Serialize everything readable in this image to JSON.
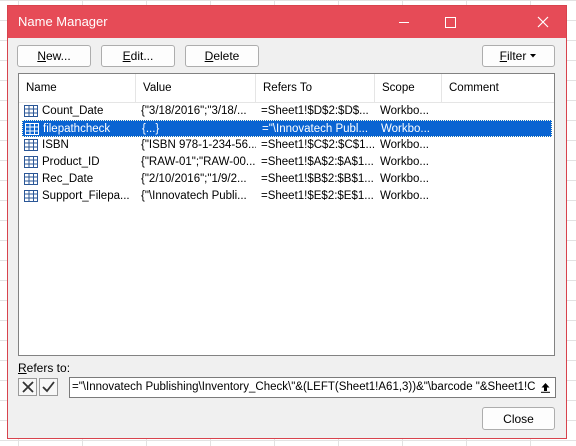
{
  "window": {
    "title": "Name Manager"
  },
  "toolbar": {
    "new_prefix": "N",
    "new_rest": "ew...",
    "edit_prefix": "E",
    "edit_rest": "dit...",
    "delete_prefix": "D",
    "delete_rest": "elete",
    "filter_prefix": "F",
    "filter_rest": "ilter"
  },
  "columns": [
    "Name",
    "Value",
    "Refers To",
    "Scope",
    "Comment"
  ],
  "rows": [
    {
      "name": "Count_Date",
      "value": "{\"3/18/2016\";\"3/18/...",
      "refers": "=Sheet1!$D$2:$D$...",
      "scope": "Workbo...",
      "comment": ""
    },
    {
      "name": "filepathcheck",
      "value": "{...}",
      "refers": "=\"\\Innovatech Publ...",
      "scope": "Workbo...",
      "comment": ""
    },
    {
      "name": "ISBN",
      "value": "{\"ISBN 978-1-234-56...",
      "refers": "=Sheet1!$C$2:$C$1...",
      "scope": "Workbo...",
      "comment": ""
    },
    {
      "name": "Product_ID",
      "value": "{\"RAW-01\";\"RAW-00...",
      "refers": "=Sheet1!$A$2:$A$1...",
      "scope": "Workbo...",
      "comment": ""
    },
    {
      "name": "Rec_Date",
      "value": "{\"2/10/2016\";\"1/9/2...",
      "refers": "=Sheet1!$B$2:$B$1...",
      "scope": "Workbo...",
      "comment": ""
    },
    {
      "name": "Support_Filepa...",
      "value": "{\"\\Innovatech Publi...",
      "refers": "=Sheet1!$E$2:$E$1...",
      "scope": "Workbo...",
      "comment": ""
    }
  ],
  "selected_row": 1,
  "refers_to": {
    "label_prefix": "R",
    "label_rest": "efers to:",
    "value": "=\"\\Innovatech Publishing\\Inventory_Check\\\"&(LEFT(Sheet1!A61,3))&\"\\barcode \"&Sheet1!C"
  },
  "footer": {
    "close_label": "Close"
  },
  "colors": {
    "titlebar": "#e64b57",
    "selection": "#0a64d2"
  }
}
